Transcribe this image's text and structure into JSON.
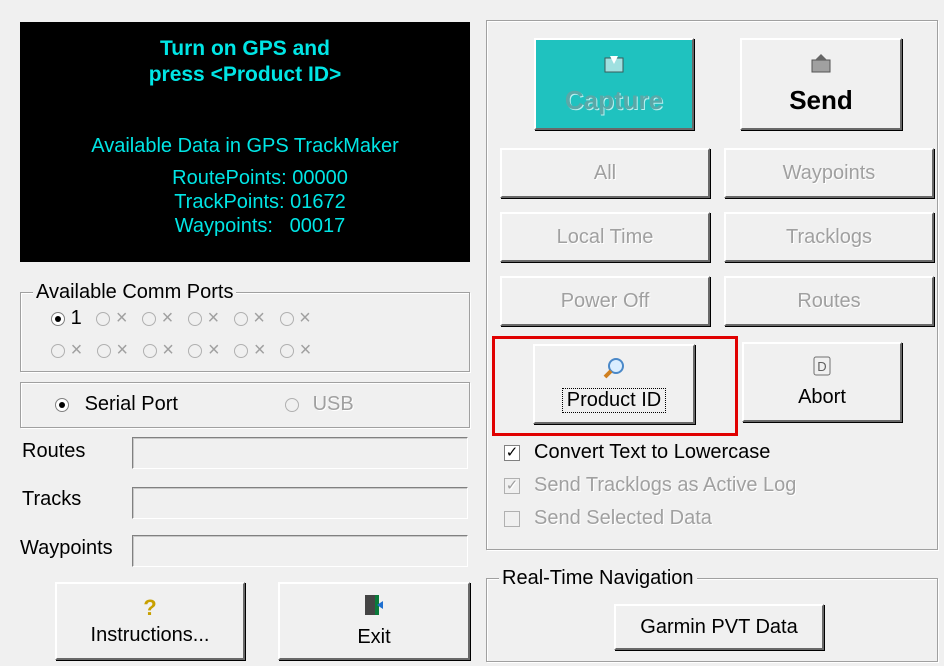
{
  "status": {
    "line1": "Turn on GPS and",
    "line2": "press <Product ID>",
    "available_heading": "Available Data in GPS TrackMaker",
    "route_points": "RoutePoints: 00000",
    "track_points": "TrackPoints: 01672",
    "waypoints": "Waypoints:   00017"
  },
  "comm_ports": {
    "legend": "Available Comm Ports",
    "port1_label": "1",
    "disabled_label": "×"
  },
  "connection": {
    "serial_label": "Serial Port",
    "usb_label": "USB"
  },
  "fields": {
    "routes_label": "Routes",
    "tracks_label": "Tracks",
    "waypoints_label": "Waypoints"
  },
  "bottom_buttons": {
    "instructions_label": "Instructions...",
    "exit_label": "Exit"
  },
  "actions": {
    "capture_label": "Capture",
    "send_label": "Send",
    "all_label": "All",
    "waypoints_label": "Waypoints",
    "local_time_label": "Local Time",
    "tracklogs_label": "Tracklogs",
    "power_off_label": "Power Off",
    "routes_label": "Routes",
    "product_id_label": "Product ID",
    "abort_label": "Abort"
  },
  "options": {
    "convert_lowercase": "Convert Text to Lowercase",
    "send_active_log": "Send Tracklogs as Active Log",
    "send_selected": "Send Selected Data"
  },
  "realtime": {
    "legend": "Real-Time Navigation",
    "garmin_pvt_label": "Garmin PVT Data"
  },
  "colors": {
    "capture_bg": "#1fc2bf",
    "status_text": "#00e5e5",
    "highlight": "#e00000"
  }
}
